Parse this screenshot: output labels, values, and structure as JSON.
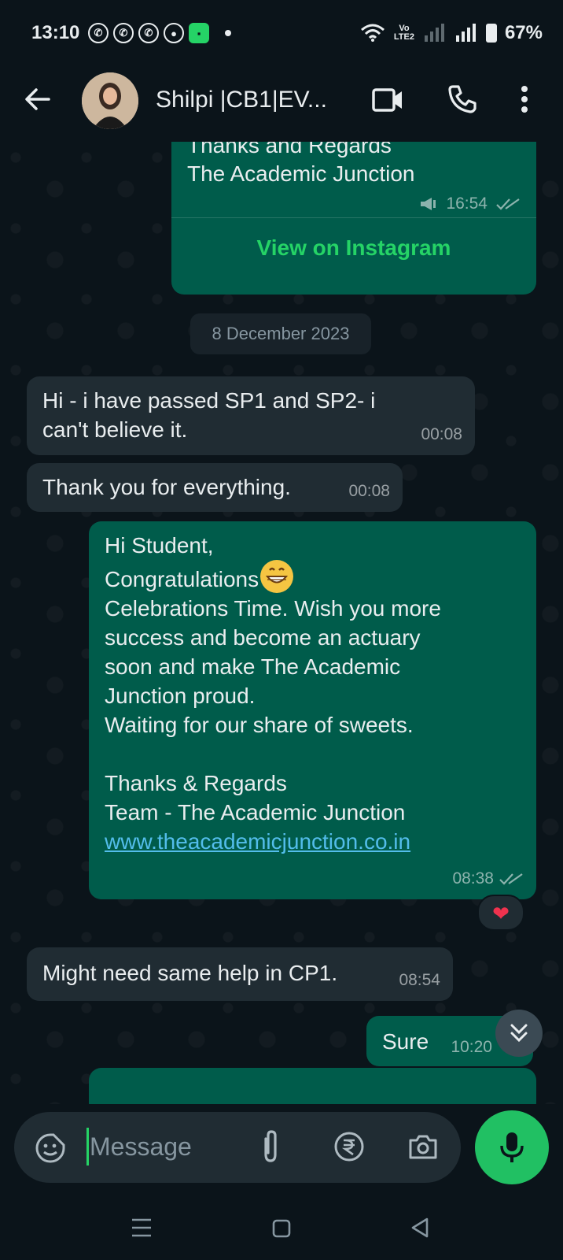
{
  "status_bar": {
    "time": "13:10",
    "battery": "67%",
    "network_label": "Vo LTE2",
    "notification_apps": [
      "whatsapp-icon",
      "whatsapp-icon",
      "whatsapp-icon",
      "chrome-icon",
      "app-icon"
    ]
  },
  "header": {
    "contact_name": "Shilpi |CB1|EV..."
  },
  "messages": {
    "m1": {
      "line1": "Thanks and Regards",
      "line2": "The Academic Junction",
      "time": "16:54",
      "cta": "View on Instagram"
    },
    "date_divider": "8 December 2023",
    "m2": {
      "line1": "Hi - i have passed SP1 and SP2- i",
      "line2": "can't believe it.",
      "time": "00:08"
    },
    "m3": {
      "text": "Thank you for everything.",
      "time": "00:08"
    },
    "m4": {
      "lines": [
        "Hi Student,",
        "Congratulations",
        "Celebrations Time. Wish you more",
        "success and become an actuary",
        "soon and make The Academic",
        "Junction proud.",
        "Waiting for our share of sweets.",
        "",
        "Thanks & Regards",
        "Team - The Academic Junction"
      ],
      "url": "www.theacademicjunction.co.in",
      "time": "08:38",
      "reaction": "❤"
    },
    "m5": {
      "text": "Might need same help in CP1.",
      "time": "08:54"
    },
    "m6": {
      "text": "Sure",
      "time": "10:20"
    }
  },
  "composer": {
    "placeholder": "Message"
  },
  "colors": {
    "background": "#0b141a",
    "incoming_bubble": "#202c33",
    "outgoing_bubble": "#005c4b",
    "accent_green": "#25d366",
    "link_blue": "#53bdeb"
  }
}
